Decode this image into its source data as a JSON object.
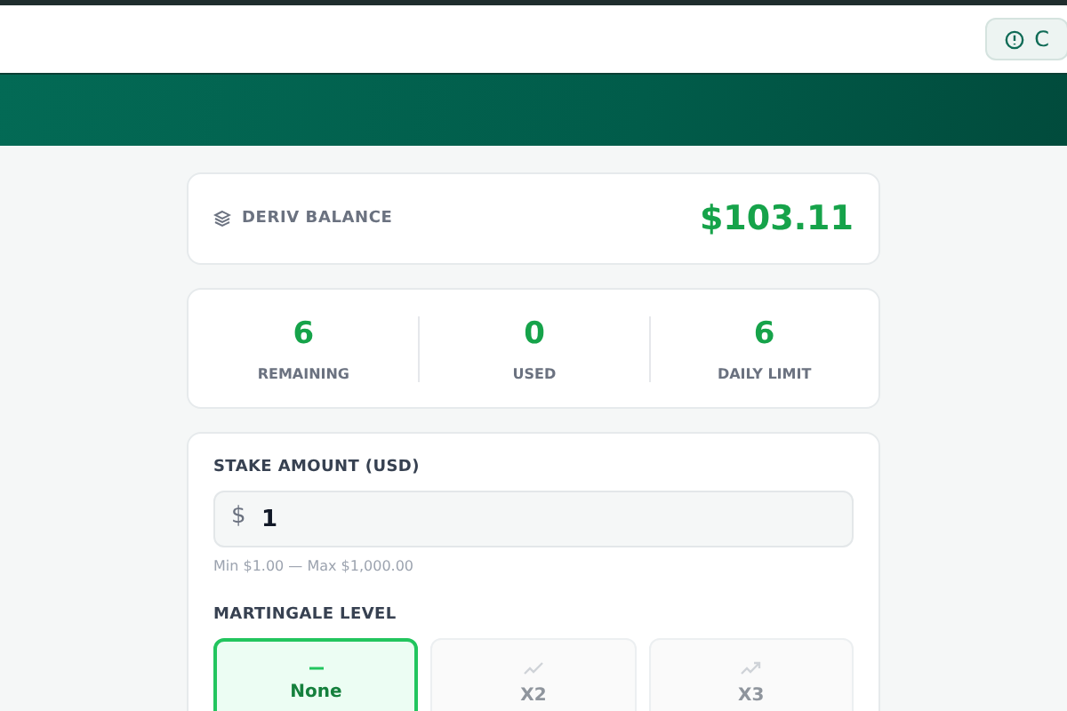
{
  "header": {
    "notice_button": "C"
  },
  "balance": {
    "label": "DERIV BALANCE",
    "amount": "$103.11"
  },
  "stats": [
    {
      "value": "6",
      "label": "REMAINING"
    },
    {
      "value": "0",
      "label": "USED"
    },
    {
      "value": "6",
      "label": "DAILY LIMIT"
    }
  ],
  "stake": {
    "label": "STAKE AMOUNT (USD)",
    "currency": "$",
    "value": "1",
    "hint": "Min $1.00 — Max $1,000.00"
  },
  "martingale": {
    "label": "MARTINGALE LEVEL",
    "options": [
      {
        "label": "None",
        "selected": true,
        "disabled": false
      },
      {
        "label": "X2",
        "selected": false,
        "disabled": true
      },
      {
        "label": "X3",
        "selected": false,
        "disabled": true
      }
    ]
  }
}
